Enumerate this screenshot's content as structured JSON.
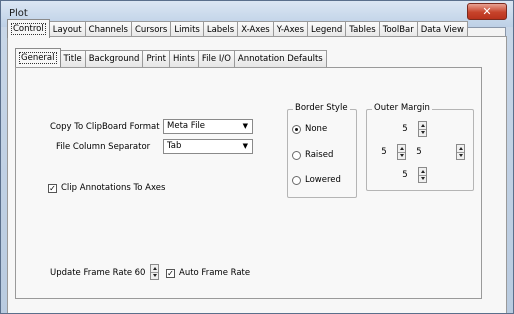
{
  "window": {
    "title": "Plot",
    "close_icon": "close-icon"
  },
  "top_tabs": [
    "Control",
    "Layout",
    "Channels",
    "Cursors",
    "Limits",
    "Labels",
    "X-Axes",
    "Y-Axes",
    "Legend",
    "Tables",
    "ToolBar",
    "Data View"
  ],
  "active_top_tab": "Control",
  "sub_tabs": [
    "General",
    "Title",
    "Background",
    "Print",
    "Hints",
    "File I/O",
    "Annotation Defaults"
  ],
  "active_sub_tab": "General",
  "general": {
    "copy_to_clipboard": {
      "label": "Copy To ClipBoard Format",
      "value": "Meta File"
    },
    "file_column_separator": {
      "label": "File Column Separator",
      "value": "Tab"
    },
    "clip_annotations": {
      "label": "Clip Annotations To Axes",
      "checked": true
    },
    "update_frame_rate": {
      "label": "Update Frame Rate",
      "value": "60"
    },
    "auto_frame_rate": {
      "label": "Auto Frame Rate",
      "checked": true
    }
  },
  "border_style": {
    "title": "Border Style",
    "options": [
      "None",
      "Raised",
      "Lowered"
    ],
    "selected": "None"
  },
  "outer_margin": {
    "title": "Outer Margin",
    "top": "5",
    "left": "5",
    "right": "5",
    "bottom": "5"
  }
}
